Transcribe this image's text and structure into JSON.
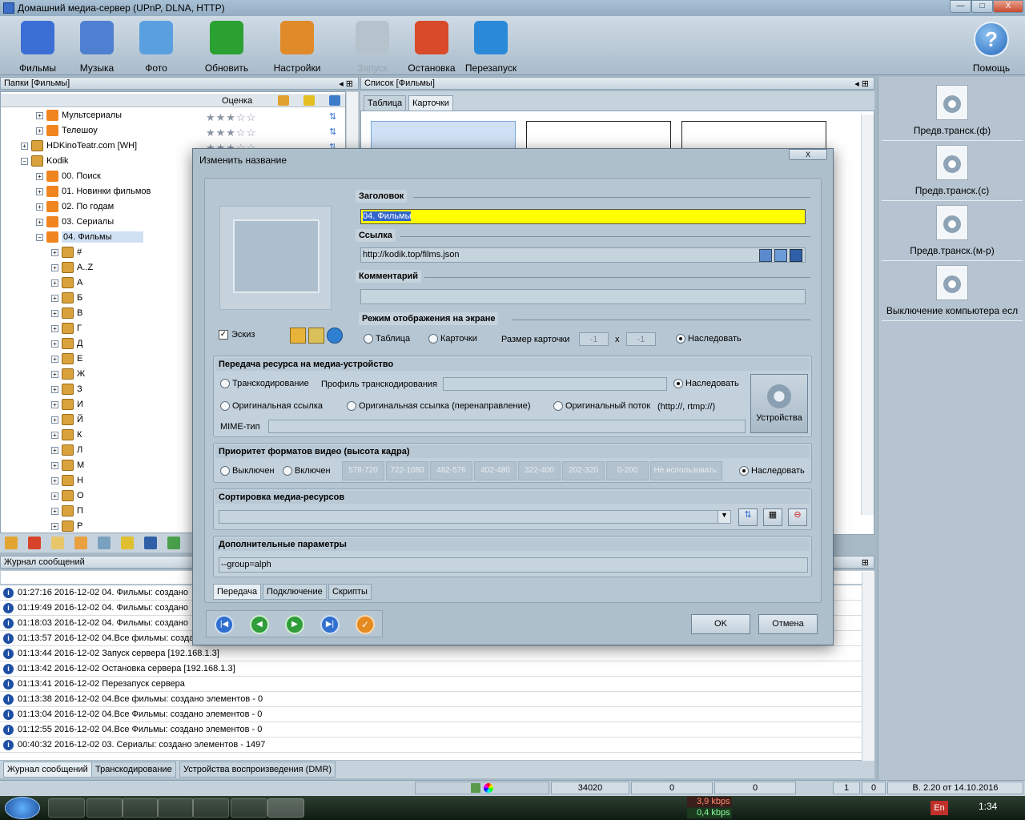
{
  "window": {
    "title": "Домашний медиа-сервер (UPnP, DLNA, HTTP)",
    "min": "—",
    "max": "□",
    "close": "X"
  },
  "toolbar": [
    {
      "name": "films-button",
      "label": "Фильмы",
      "color": "#3b6fd6"
    },
    {
      "name": "music-button",
      "label": "Музыка",
      "color": "#4f7fd0"
    },
    {
      "name": "photo-button",
      "label": "Фото",
      "color": "#5aa0e0"
    },
    {
      "name": "refresh-button",
      "label": "Обновить",
      "color": "#2aa130"
    },
    {
      "name": "settings-button",
      "label": "Настройки",
      "color": "#e08a2a"
    },
    {
      "name": "start-button",
      "label": "Запуск",
      "color": "#b7c3cc",
      "disabled": true
    },
    {
      "name": "stop-button",
      "label": "Остановка",
      "color": "#d84a2a"
    },
    {
      "name": "restart-button",
      "label": "Перезапуск",
      "color": "#2a8ad8"
    }
  ],
  "help_label": "Помощь",
  "left_panel": {
    "title": "Папки [Фильмы]",
    "col_rating": "Оценка"
  },
  "tree": [
    {
      "label": "Мультсериалы",
      "ico": "rss",
      "indent": 2,
      "stars": "★★★☆☆"
    },
    {
      "label": "Телешоу",
      "ico": "rss",
      "indent": 2,
      "stars": "★★★☆☆"
    },
    {
      "label": "HDKinoTeatr.com [WH]",
      "ico": "box",
      "indent": 1,
      "stars": "★★★☆☆"
    },
    {
      "label": "Kodik",
      "ico": "box",
      "indent": 1,
      "exp": "−"
    },
    {
      "label": "00. Поиск",
      "ico": "rss",
      "indent": 2
    },
    {
      "label": "01. Новинки фильмов",
      "ico": "rss",
      "indent": 2
    },
    {
      "label": "02. По годам",
      "ico": "rss",
      "indent": 2
    },
    {
      "label": "03. Сериалы",
      "ico": "rss",
      "indent": 2
    },
    {
      "label": "04. Фильмы",
      "ico": "rss",
      "indent": 2,
      "exp": "−",
      "sel": true
    },
    {
      "label": "#",
      "ico": "box",
      "indent": 3
    },
    {
      "label": "A..Z",
      "ico": "box",
      "indent": 3
    },
    {
      "label": "А",
      "ico": "box",
      "indent": 3
    },
    {
      "label": "Б",
      "ico": "box",
      "indent": 3
    },
    {
      "label": "В",
      "ico": "box",
      "indent": 3
    },
    {
      "label": "Г",
      "ico": "box",
      "indent": 3
    },
    {
      "label": "Д",
      "ico": "box",
      "indent": 3
    },
    {
      "label": "Е",
      "ico": "box",
      "indent": 3
    },
    {
      "label": "Ж",
      "ico": "box",
      "indent": 3
    },
    {
      "label": "З",
      "ico": "box",
      "indent": 3
    },
    {
      "label": "И",
      "ico": "box",
      "indent": 3
    },
    {
      "label": "Й",
      "ico": "box",
      "indent": 3
    },
    {
      "label": "К",
      "ico": "box",
      "indent": 3
    },
    {
      "label": "Л",
      "ico": "box",
      "indent": 3
    },
    {
      "label": "М",
      "ico": "box",
      "indent": 3
    },
    {
      "label": "Н",
      "ico": "box",
      "indent": 3
    },
    {
      "label": "О",
      "ico": "box",
      "indent": 3
    },
    {
      "label": "П",
      "ico": "box",
      "indent": 3
    },
    {
      "label": "Р",
      "ico": "box",
      "indent": 3
    }
  ],
  "list_panel": {
    "title": "Список [Фильмы]",
    "tab_table": "Таблица",
    "tab_cards": "Карточки"
  },
  "right_panel": [
    "Предв.транск.(ф)",
    "Предв.транск.(с)",
    "Предв.транск.(м-р)",
    "Выключение компьютера есл"
  ],
  "log": {
    "title": "Журнал сообщений",
    "rows": [
      "01:27:16 2016-12-02 04. Фильмы: создано",
      "01:19:49 2016-12-02 04. Фильмы: создано",
      "01:18:03 2016-12-02 04. Фильмы: создано",
      "01:13:57 2016-12-02 04.Все фильмы: созда",
      "01:13:44 2016-12-02 Запуск сервера [192.168.1.3]",
      "01:13:42 2016-12-02 Остановка сервера [192.168.1.3]",
      "01:13:41 2016-12-02 Перезапуск сервера",
      "01:13:38 2016-12-02 04.Все фильмы: создано элементов - 0",
      "01:13:04 2016-12-02 04.Все Фильмы: создано элементов - 0",
      "01:12:55 2016-12-02 04.Все Фильмы: создано элементов - 0",
      "00:40:32 2016-12-02 03. Сериалы: создано элементов - 1497"
    ],
    "tabs": [
      "Журнал сообщений",
      "Транскодирование",
      "Устройства воспроизведения (DMR)"
    ]
  },
  "status": {
    "count": "34020",
    "v1": "0",
    "v2": "0",
    "v3": "1",
    "v4": "0",
    "version": "В. 2.20 от 14.10.2016"
  },
  "dialog": {
    "title": "Изменить название",
    "close": "X",
    "header_label": "Заголовок",
    "header_value": "04. Фильмы",
    "link_label": "Ссылка",
    "link_value": "http://kodik.top/films.json",
    "comment_label": "Комментарий",
    "comment_value": "",
    "thumb_label": "Эскиз",
    "display_label": "Режим отображения на экране",
    "display_table": "Таблица",
    "display_cards": "Карточки",
    "card_size_label": "Размер карточки",
    "card_w": "-1",
    "card_x": "x",
    "card_h": "-1",
    "inherit": "Наследовать",
    "transfer_label": "Передача ресурса на медиа-устройство",
    "transcoding": "Транскодирование",
    "transcode_profile": "Профиль транскодирования",
    "orig_link": "Оригинальная ссылка",
    "orig_redirect": "Оригинальная ссылка (перенаправление)",
    "orig_stream": "Оригинальный поток",
    "orig_stream_hint": "(http://, rtmp://)",
    "mime_label": "MIME-тип",
    "devices": "Устройства",
    "priority_label": "Приоритет форматов видео (высота кадра)",
    "off": "Выключен",
    "on": "Включен",
    "formats": [
      "578-720",
      "722-1080",
      "482-576",
      "402-480",
      "322-400",
      "202-320",
      "0-200",
      "Не использовать:"
    ],
    "sort_label": "Сортировка медиа-ресурсов",
    "extra_label": "Дополнительные параметры",
    "extra_value": "--group=alph",
    "tabs": [
      "Передача",
      "Подключение",
      "Скрипты"
    ],
    "ok": "OK",
    "cancel": "Отмена"
  },
  "taskbar": {
    "kbps_down": "3,9 kbps",
    "kbps_up": "0,4 kbps",
    "lang": "En",
    "time": "1:34"
  }
}
